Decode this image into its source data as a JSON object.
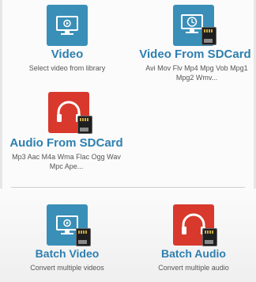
{
  "tiles": [
    {
      "title": "Video",
      "subtitle": "Select video from library",
      "icon": "monitor-play-icon"
    },
    {
      "title": "Video From SDCard",
      "subtitle": "Avi Mov Flv Mp4 Mpg Vob Mpg1 Mpg2 Wmv...",
      "icon": "monitor-sdcard-icon"
    },
    {
      "title": "Audio From SDCard",
      "subtitle": "Mp3 Aac M4a Wma Flac Ogg Wav Mpc Ape...",
      "icon": "headphones-sdcard-icon"
    },
    {
      "title": "Batch Video",
      "subtitle": "Convert multiple videos",
      "icon": "monitor-batch-icon"
    },
    {
      "title": "Batch Audio",
      "subtitle": "Convert multiple audio",
      "icon": "headphones-batch-icon"
    }
  ],
  "colors": {
    "accent": "#2e7fb0",
    "blue_tile": "#3a8fb8",
    "red_tile": "#d8392c"
  }
}
